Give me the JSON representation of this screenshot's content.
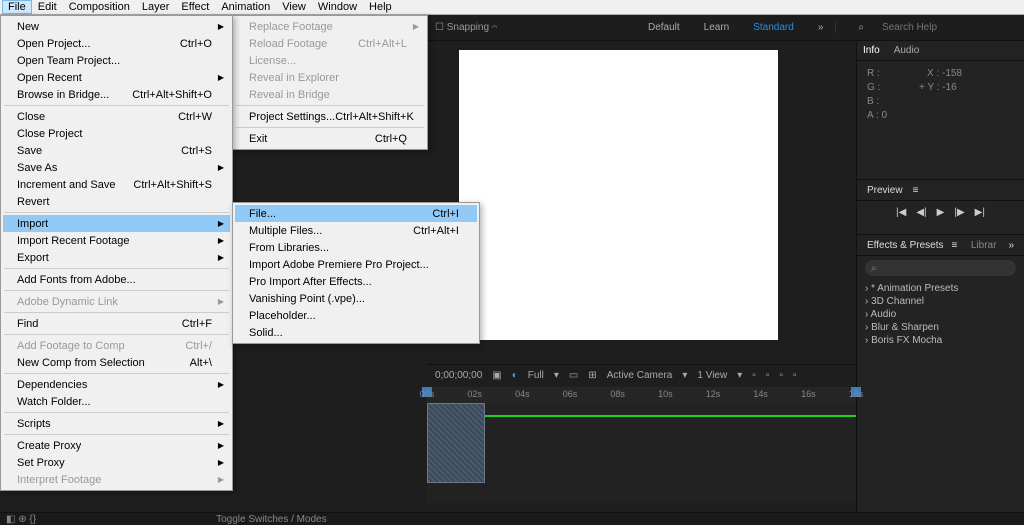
{
  "menubar": [
    "File",
    "Edit",
    "Composition",
    "Layer",
    "Effect",
    "Animation",
    "View",
    "Window",
    "Help"
  ],
  "fileMenu": [
    {
      "label": "New",
      "arrow": true
    },
    {
      "label": "Open Project...",
      "sc": "Ctrl+O"
    },
    {
      "label": "Open Team Project..."
    },
    {
      "label": "Open Recent",
      "arrow": true
    },
    {
      "label": "Browse in Bridge...",
      "sc": "Ctrl+Alt+Shift+O"
    },
    {
      "sep": true
    },
    {
      "label": "Close",
      "sc": "Ctrl+W"
    },
    {
      "label": "Close Project"
    },
    {
      "label": "Save",
      "sc": "Ctrl+S"
    },
    {
      "label": "Save As",
      "arrow": true
    },
    {
      "label": "Increment and Save",
      "sc": "Ctrl+Alt+Shift+S"
    },
    {
      "label": "Revert"
    },
    {
      "sep": true
    },
    {
      "label": "Import",
      "arrow": true,
      "sel": true
    },
    {
      "label": "Import Recent Footage",
      "arrow": true
    },
    {
      "label": "Export",
      "arrow": true
    },
    {
      "sep": true
    },
    {
      "label": "Add Fonts from Adobe..."
    },
    {
      "sep": true
    },
    {
      "label": "Adobe Dynamic Link",
      "arrow": true,
      "dis": true
    },
    {
      "sep": true
    },
    {
      "label": "Find",
      "sc": "Ctrl+F"
    },
    {
      "sep": true
    },
    {
      "label": "Add Footage to Comp",
      "sc": "Ctrl+/",
      "dis": true
    },
    {
      "label": "New Comp from Selection",
      "sc": "Alt+\\"
    },
    {
      "sep": true
    },
    {
      "label": "Dependencies",
      "arrow": true
    },
    {
      "label": "Watch Folder..."
    },
    {
      "sep": true
    },
    {
      "label": "Scripts",
      "arrow": true
    },
    {
      "sep": true
    },
    {
      "label": "Create Proxy",
      "arrow": true
    },
    {
      "label": "Set Proxy",
      "arrow": true
    },
    {
      "label": "Interpret Footage",
      "arrow": true,
      "dis": true
    }
  ],
  "newMenu": [
    {
      "label": "Replace Footage",
      "arrow": true,
      "dis": true
    },
    {
      "label": "Reload Footage",
      "sc": "Ctrl+Alt+L",
      "dis": true
    },
    {
      "label": "License...",
      "dis": true
    },
    {
      "label": "Reveal in Explorer",
      "dis": true
    },
    {
      "label": "Reveal in Bridge",
      "dis": true
    },
    {
      "sep": true
    },
    {
      "label": "Project Settings...",
      "sc": "Ctrl+Alt+Shift+K"
    },
    {
      "sep": true
    },
    {
      "label": "Exit",
      "sc": "Ctrl+Q"
    }
  ],
  "importMenu": [
    {
      "label": "File...",
      "sc": "Ctrl+I",
      "sel": true
    },
    {
      "label": "Multiple Files...",
      "sc": "Ctrl+Alt+I"
    },
    {
      "label": "From Libraries..."
    },
    {
      "label": "Import Adobe Premiere Pro Project..."
    },
    {
      "label": "Pro Import After Effects..."
    },
    {
      "label": "Vanishing Point (.vpe)..."
    },
    {
      "label": "Placeholder..."
    },
    {
      "label": "Solid..."
    }
  ],
  "toolbar": {
    "snap": "Snapping",
    "ws": [
      "Default",
      "Learn",
      "Standard"
    ],
    "help": "Search Help"
  },
  "info": {
    "tabs": [
      "Info",
      "Audio"
    ],
    "rows": {
      "R": "",
      "G": "",
      "B": "",
      "A": "0"
    },
    "pos": {
      "X": "-158",
      "Y": "-16"
    }
  },
  "preview": {
    "title": "Preview"
  },
  "effects": {
    "title": "Effects & Presets",
    "lib": "Librar",
    "items": [
      "* Animation Presets",
      "3D Channel",
      "Audio",
      "Blur & Sharpen",
      "Boris FX Mocha"
    ]
  },
  "timeline": {
    "time": "0;00;00;00",
    "full": "Full",
    "cam": "Active Camera",
    "view": "1 View",
    "ticks": [
      "00s",
      "02s",
      "04s",
      "06s",
      "08s",
      "10s",
      "12s",
      "14s",
      "16s",
      "18s"
    ]
  },
  "status": {
    "toggle": "Toggle Switches / Modes"
  }
}
